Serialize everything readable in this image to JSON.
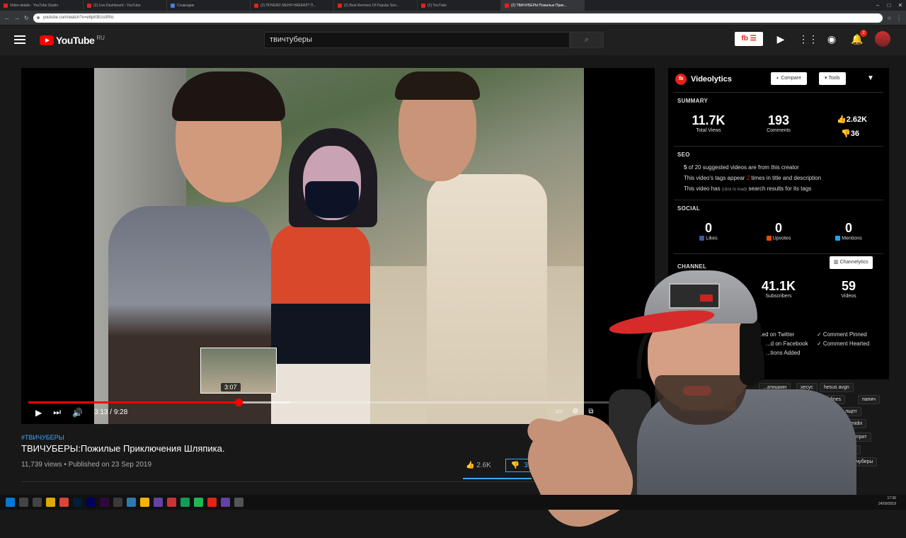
{
  "browser": {
    "tabs": [
      {
        "label": "Video details - YouTube Studio",
        "fav": "red"
      },
      {
        "label": "(2) Live Dashboard - YouTube",
        "fav": "red"
      },
      {
        "label": "Созвездие",
        "fav": "blue"
      },
      {
        "label": "(2) ПОЧЕМУ МЕНЯ НАЕБАЛ? П...",
        "fav": "red"
      },
      {
        "label": "(2) Best Remixes Of Popular Son...",
        "fav": "red"
      },
      {
        "label": "(2) YouTube",
        "fav": "red"
      },
      {
        "label": "(2) ТВИЧУБЕРЫ:Пожилые Прик...",
        "fav": "red",
        "active": true
      }
    ],
    "url": "youtube.com/watch?v=e6pKBUo3RIo"
  },
  "header": {
    "logo_text": "YouTube",
    "region": "RU",
    "search_value": "твичтуберы",
    "vl_button": "fb ☰",
    "notif_count": "2"
  },
  "player": {
    "time_current": "3:13",
    "time_sep": " / ",
    "time_total": "9:28",
    "preview_time": "3:07",
    "progress": 0.34
  },
  "video": {
    "hashtag": "#ТВИЧУБЕРЫ",
    "title": "ТВИЧУБЕРЫ:Пожилые Приключения Шляпика.",
    "meta": "11,739 views • Published on 23 Sep 2019",
    "likes": "2.6K",
    "dislikes": "37"
  },
  "videolytics": {
    "name": "Videolytics",
    "compare": "Compare",
    "tools": "Tools",
    "summary_title": "SUMMARY",
    "total_views": "11.7K",
    "total_views_label": "Total Views",
    "comments": "193",
    "comments_label": "Comments",
    "likes": "2.62K",
    "dislikes": "36",
    "seo_title": "SEO",
    "seo_1a": "5",
    "seo_1b": " of 20 suggested videos are from this creator",
    "seo_2a": "This video's tags appear ",
    "seo_2b": "2",
    "seo_2c": " times in title and description",
    "seo_3a": "This video has ",
    "seo_3b": "(click to load)",
    "seo_3c": " search results for its tags",
    "social_title": "SOCIAL",
    "social_likes": "0",
    "social_likes_label": "Likes",
    "social_upvotes": "0",
    "social_upvotes_label": "Upvotes",
    "social_mentions": "0",
    "social_mentions_label": "Mentions",
    "channel_title": "CHANNEL",
    "channelytics": "Channelytics",
    "subscribers": "41.1K",
    "subscribers_label": "Subscribers",
    "videos": "59",
    "videos_label": "Videos",
    "feat_1": "...ed on Twitter",
    "feat_2": "✓ Comment Pinned",
    "feat_3": "...d on Facebook",
    "feat_4": "✓ Comment Hearted",
    "feat_5": "...tions Added",
    "tags": [
      "...атишкин",
      "хесус",
      "hesus avgn",
      "...лакас",
      "жмых airlines",
      "папич",
      "...естал",
      "лщпт",
      "...ция",
      "midix",
      "...акас смотрит",
      "...отрит",
      "...вичуберы"
    ]
  },
  "taskbar": {
    "time": "17:36",
    "date": "24/09/2019"
  }
}
